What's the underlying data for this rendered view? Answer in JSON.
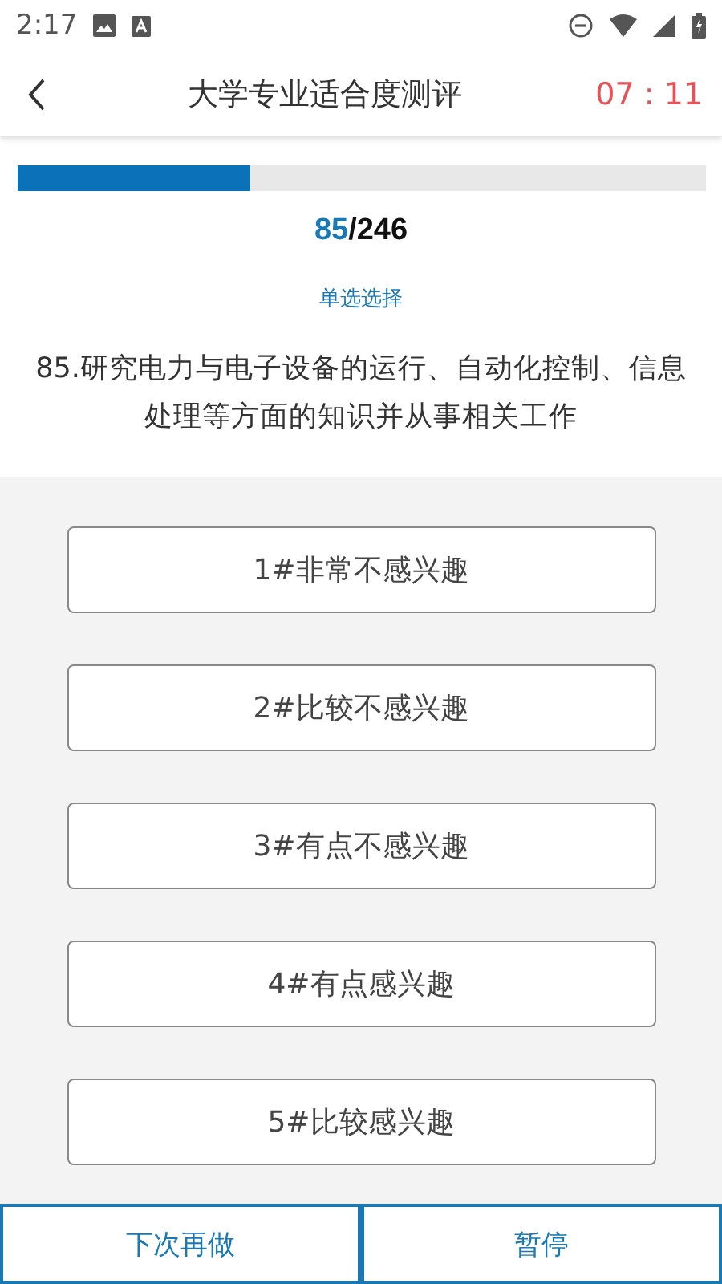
{
  "status_bar": {
    "time": "2:17"
  },
  "header": {
    "title": "大学专业适合度测评",
    "timer": "07 : 11"
  },
  "progress": {
    "level": 0.34,
    "current": "85",
    "total": "/246"
  },
  "question_type": "单选选择",
  "question": "85.研究电力与电子设备的运行、自动化控制、信息处理等方面的知识并从事相关工作",
  "options": [
    {
      "label": "1#非常不感兴趣",
      "selected": false
    },
    {
      "label": "2#比较不感兴趣",
      "selected": false
    },
    {
      "label": "3#有点不感兴趣",
      "selected": false
    },
    {
      "label": "4#有点感兴趣",
      "selected": false
    },
    {
      "label": "5#比较感兴趣",
      "selected": false
    }
  ],
  "buttons": [
    "下次再做",
    "暂停"
  ]
}
